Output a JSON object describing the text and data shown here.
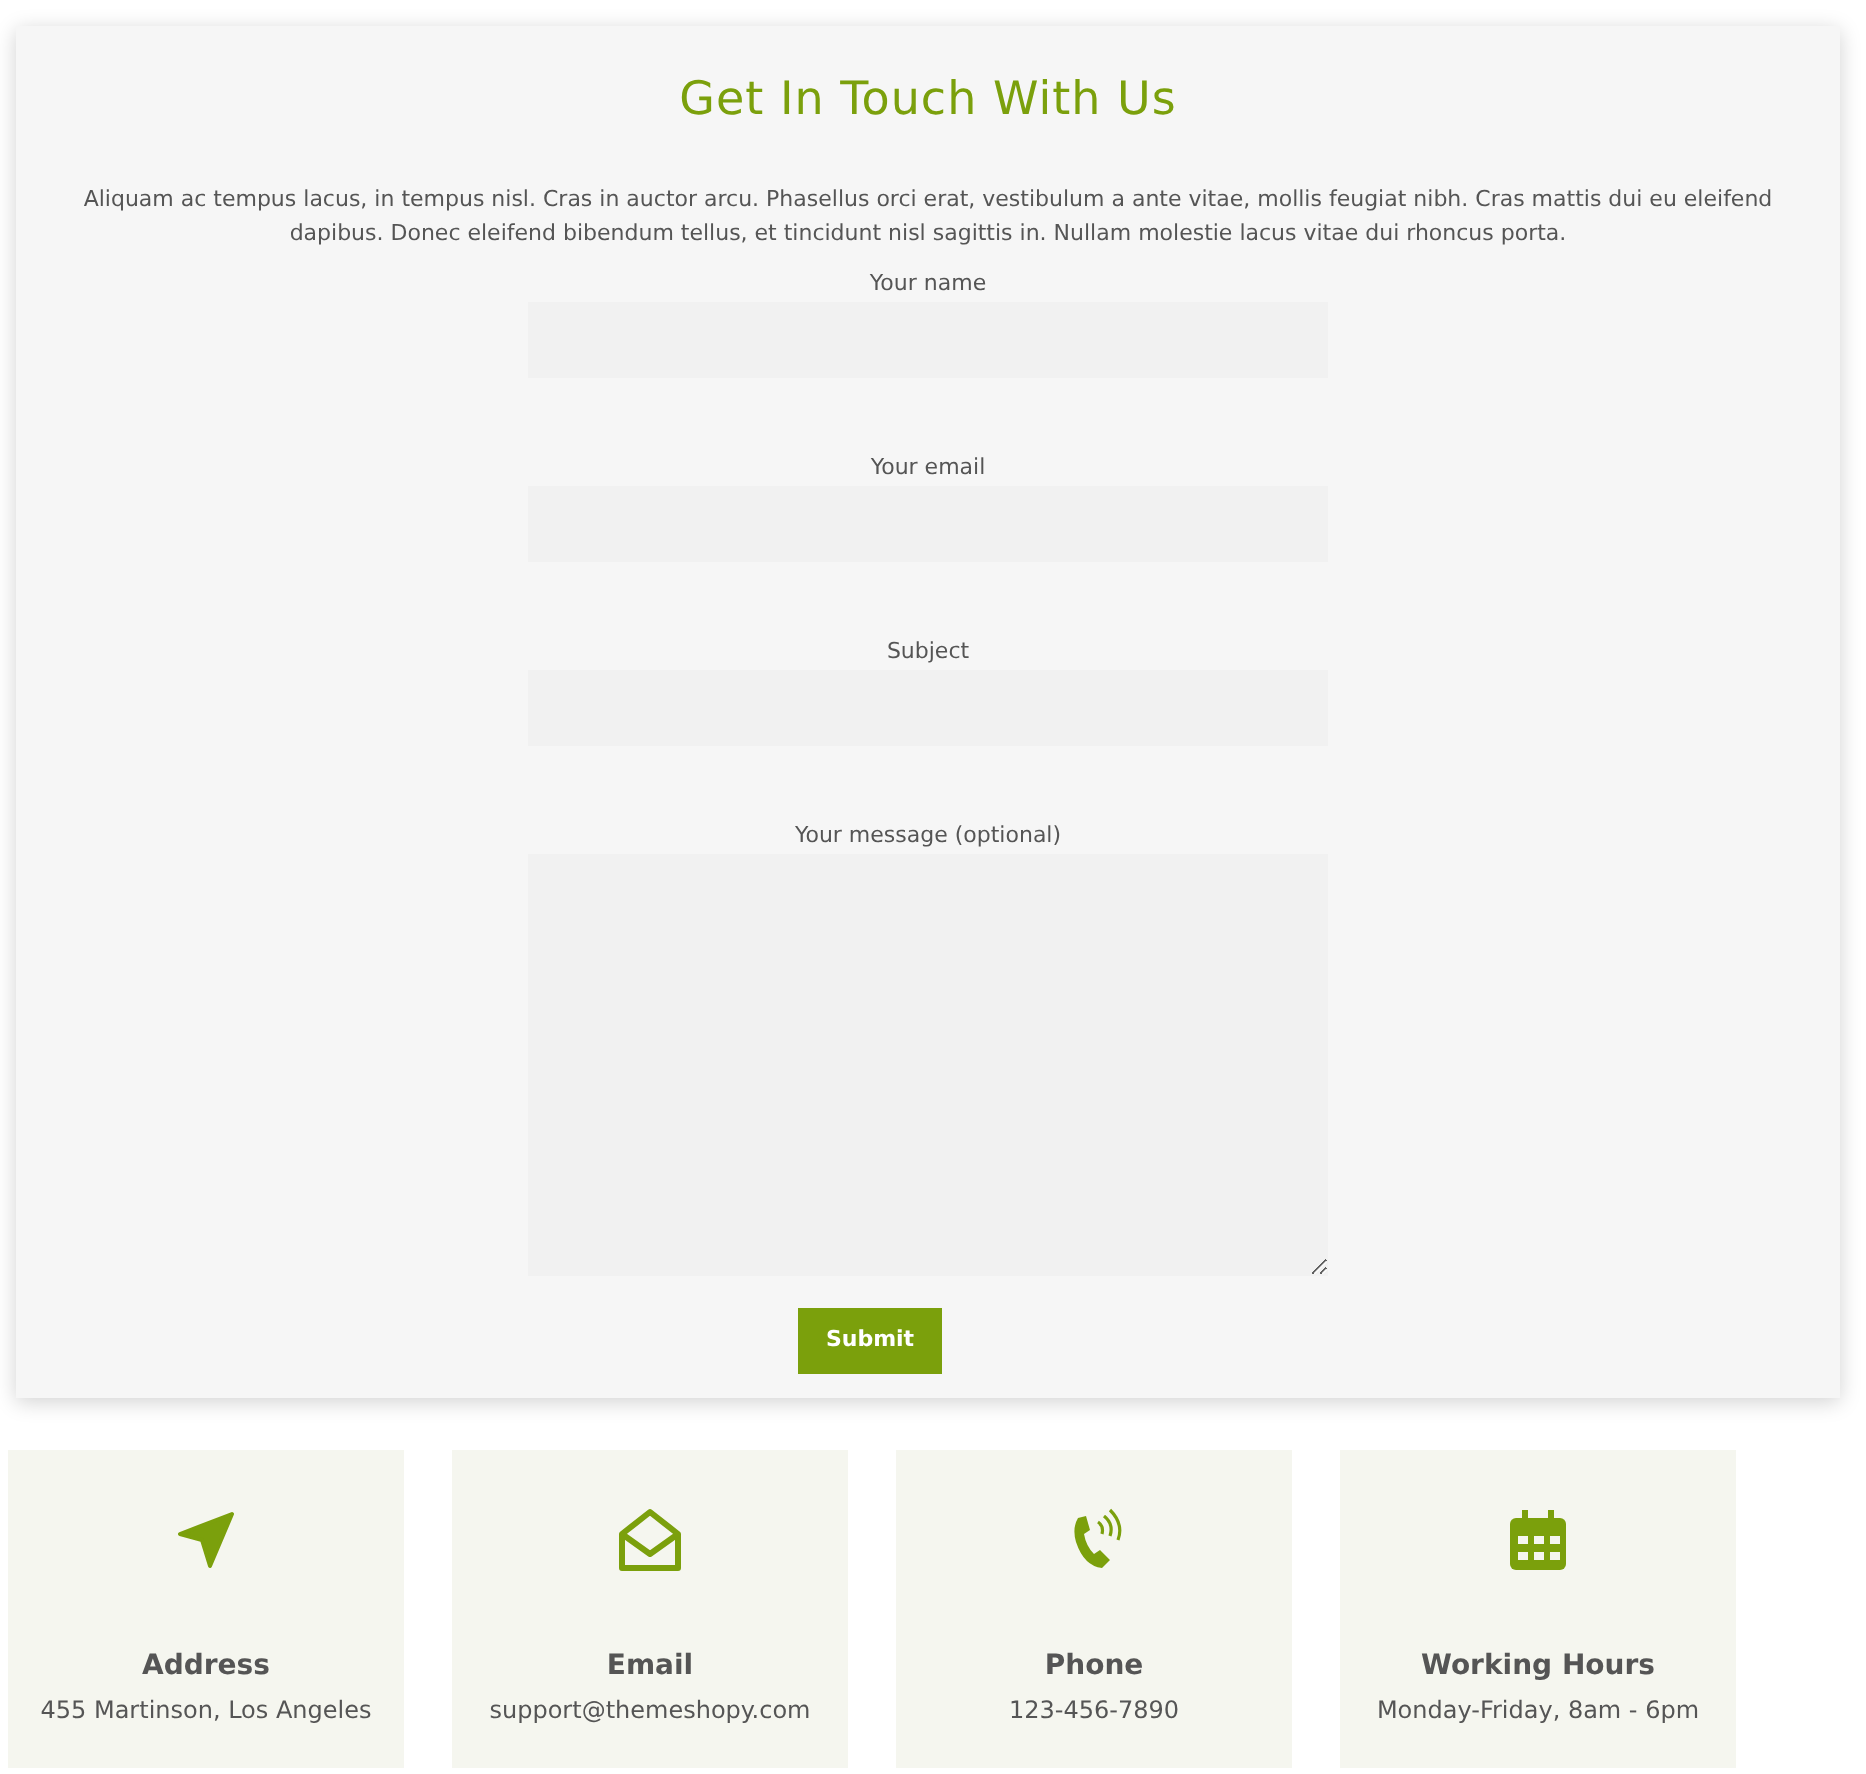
{
  "contact": {
    "title": "Get In Touch With Us",
    "intro": "Aliquam ac tempus lacus, in tempus nisl. Cras in auctor arcu. Phasellus orci erat, vestibulum a ante vitae, mollis feugiat nibh. Cras mattis dui eu eleifend dapibus. Donec eleifend bibendum tellus, et tincidunt nisl sagittis in. Nullam molestie lacus vitae dui rhoncus porta.",
    "fields": [
      {
        "label": "Your name",
        "kind": "input"
      },
      {
        "label": "Your email",
        "kind": "input"
      },
      {
        "label": "Subject",
        "kind": "input"
      },
      {
        "label": "Your message (optional)",
        "kind": "textarea"
      }
    ],
    "submit": "Submit"
  },
  "info_cards": [
    {
      "kind": "navigation",
      "title": "Address",
      "text": "455 Martinson, Los Angeles"
    },
    {
      "kind": "envelope",
      "title": "Email",
      "text": "support@themeshopy.com"
    },
    {
      "kind": "phone",
      "title": "Phone",
      "text": "123-456-7890"
    },
    {
      "kind": "calendar",
      "title": "Working Hours",
      "text": "Monday-Friday, 8am - 6pm"
    }
  ]
}
